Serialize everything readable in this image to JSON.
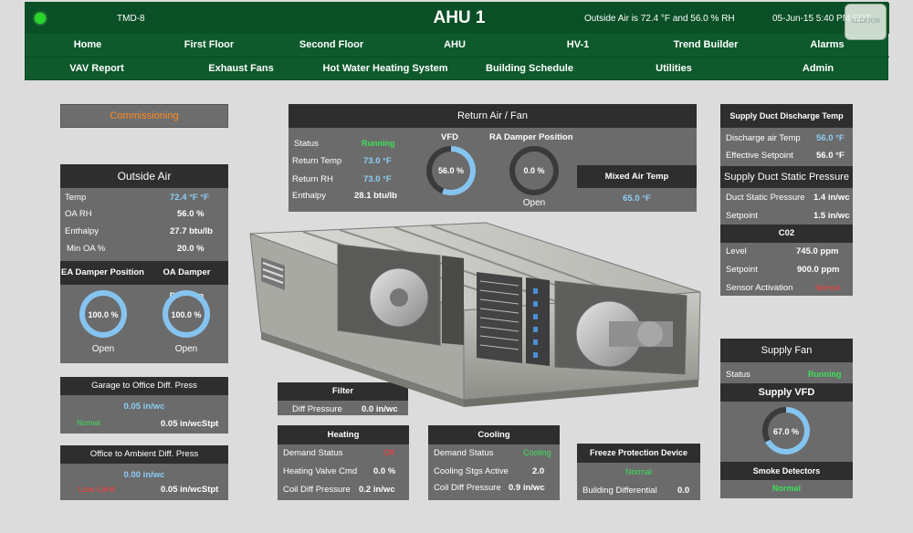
{
  "header": {
    "tmd": "TMD-8",
    "title": "AHU 1",
    "outside_air": "Outside Air is 72.4 °F  and  56.0 % RH",
    "datetime": "05-Jun-15 5:40 PM EDT",
    "status_light_color": "#29d52a",
    "logo_text": "ALERTON"
  },
  "nav": {
    "row1": [
      "Home",
      "First Floor",
      "Second Floor",
      "AHU",
      "HV-1",
      "Trend Builder",
      "Alarms"
    ],
    "row2": [
      "VAV Report",
      "Exhaust Fans",
      "Hot Water Heating System",
      "Building Schedule",
      "Utilities",
      "Admin"
    ]
  },
  "commissioning": "Commissioning",
  "outside_air": {
    "title": "Outside Air",
    "temp_label": "Temp",
    "temp_value": "72.4 °F °F",
    "rh_label": "OA RH",
    "rh_value": "56.0 %",
    "enthalpy_label": "Enthalpy",
    "enthalpy_value": "27.7 btu/lb",
    "minoa_label": "Min OA %",
    "minoa_value": "20.0 %",
    "ea_damper_title": "EA Damper Position",
    "oa_damper_title": "OA Damper Position",
    "ea_value": "100.0 %",
    "ea_pct": 100,
    "ea_state": "Open",
    "oa_value": "100.0 %",
    "oa_pct": 100,
    "oa_state": "Open"
  },
  "garage_diff": {
    "title": "Garage to Office Diff. Press",
    "value": "0.05 in/wc",
    "status": "Normal",
    "stpt": "0.05 in/wcStpt"
  },
  "office_diff": {
    "title": "Office to Ambient Diff. Press",
    "value": "0.00 in/wc",
    "status": "Low Limit",
    "stpt": "0.05 in/wcStpt"
  },
  "return_air": {
    "title": "Return Air / Fan",
    "status_label": "Status",
    "status_value": "Running",
    "temp_label": "Return Temp",
    "temp_value": "73.0 °F",
    "rh_label": "Return RH",
    "rh_value": "73.0 °F",
    "enthalpy_label": "Enthalpy",
    "enthalpy_value": "28.1 btu/lb",
    "vfd_title": "VFD",
    "vfd_value": "56.0 %",
    "vfd_pct": 56,
    "ra_damper_title": "RA Damper Position",
    "ra_value": "0.0 %",
    "ra_pct": 0,
    "ra_state": "Open",
    "mixed_title": "Mixed Air Temp",
    "mixed_value": "65.0 °F"
  },
  "supply_duct": {
    "title": "Supply Duct Discharge Temp",
    "discharge_label": "Discharge air Temp",
    "discharge_value": "56.0 °F",
    "setpoint_label": "Effective Setpoint",
    "setpoint_value": "56.0 °F",
    "static_title": "Supply Duct Static Pressure",
    "static_label": "Duct Static Pressure",
    "static_value": "1.4 in/wc",
    "static_sp_label": "Setpoint",
    "static_sp_value": "1.5 in/wc",
    "co2_title": "C02",
    "co2_level_label": "Level",
    "co2_level_value": "745.0 ppm",
    "co2_sp_label": "Setpoint",
    "co2_sp_value": "900.0 ppm",
    "co2_sensor_label": "Sensor Activation",
    "co2_sensor_value": "Normal"
  },
  "supply_fan": {
    "title": "Supply Fan",
    "status_label": "Status",
    "status_value": "Running",
    "vfd_title": "Supply VFD",
    "vfd_value": "67.0 %",
    "vfd_pct": 67,
    "smoke_title": "Smoke Detectors",
    "smoke_value": "Normal"
  },
  "filter": {
    "title": "Filter",
    "label": "Diff Pressure",
    "value": "0.0 in/wc"
  },
  "heating": {
    "title": "Heating",
    "demand_label": "Demand Status",
    "demand_value": "Off",
    "valve_label": "Heating Valve Cmd",
    "valve_value": "0.0 %",
    "coil_label": "Coil Diff Pressure",
    "coil_value": "0.2 in/wc"
  },
  "cooling": {
    "title": "Cooling",
    "demand_label": "Demand Status",
    "demand_value": "Cooling",
    "stgs_label": "Cooling Stgs Active",
    "stgs_value": "2.0",
    "coil_label": "Coil Diff Pressure",
    "coil_value": "0.9 in/wc"
  },
  "freeze": {
    "title": "Freeze Protection Device",
    "status": "Normal",
    "diff_label": "Building Differential",
    "diff_value": "0.0"
  }
}
